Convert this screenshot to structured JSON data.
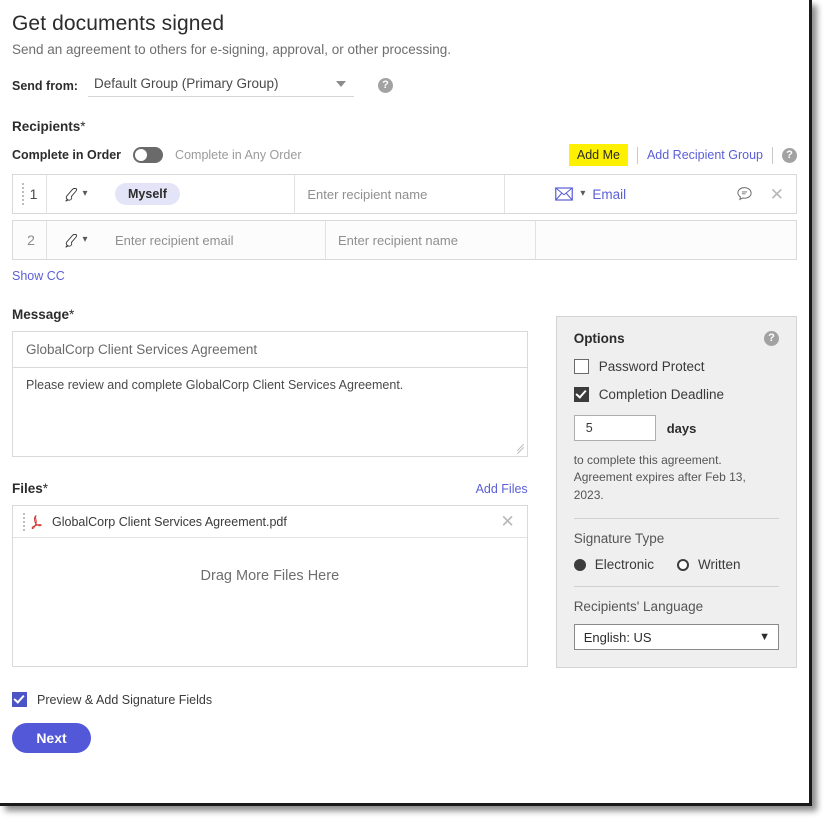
{
  "header": {
    "title": "Get documents signed",
    "subtitle": "Send an agreement to others for e-signing, approval, or other processing.",
    "send_from_label": "Send from:",
    "send_from_value": "Default Group (Primary Group)",
    "help_glyph": "?"
  },
  "recipients": {
    "section_label": "Recipients",
    "required_mark": "*",
    "complete_in_order_label": "Complete in Order",
    "complete_in_any_order_label": "Complete in Any Order",
    "toggle_state": "off",
    "add_me_label": "Add Me",
    "add_me_highlight_color": "#fdf000",
    "add_recipient_group_label": "Add Recipient Group",
    "show_cc_label": "Show CC",
    "rows": [
      {
        "number": "1",
        "role_icon": "signature-pen-icon",
        "email_chip": "Myself",
        "name_placeholder": "Enter recipient name",
        "method_label": "Email",
        "method_icon": "envelope-icon",
        "comment_icon": "speech-bubble-icon",
        "remove_icon": "close-icon"
      },
      {
        "number": "2",
        "role_icon": "signature-pen-icon",
        "email_placeholder": "Enter recipient email",
        "name_placeholder": "Enter recipient name"
      }
    ]
  },
  "message": {
    "section_label": "Message",
    "required_mark": "*",
    "subject_value": "GlobalCorp Client Services Agreement",
    "body_value": "Please review and complete GlobalCorp Client Services Agreement."
  },
  "files": {
    "section_label": "Files",
    "required_mark": "*",
    "add_files_label": "Add Files",
    "file_name": "GlobalCorp Client Services Agreement.pdf",
    "file_icon": "pdf-icon",
    "remove_icon": "close-icon",
    "drop_zone_label": "Drag More Files Here"
  },
  "options": {
    "title": "Options",
    "password_protect_label": "Password Protect",
    "password_protect_checked": false,
    "completion_deadline_label": "Completion Deadline",
    "completion_deadline_checked": true,
    "days_value": "5",
    "days_word": "days",
    "note_line1": "to complete this agreement.",
    "note_line2": "Agreement expires after Feb 13, 2023.",
    "signature_type_label": "Signature Type",
    "signature_electronic_label": "Electronic",
    "signature_written_label": "Written",
    "signature_selected": "Electronic",
    "language_label": "Recipients' Language",
    "language_value": "English: US"
  },
  "footer": {
    "preview_label": "Preview & Add Signature Fields",
    "preview_checked": true,
    "next_label": "Next",
    "next_color": "#5258d8"
  }
}
